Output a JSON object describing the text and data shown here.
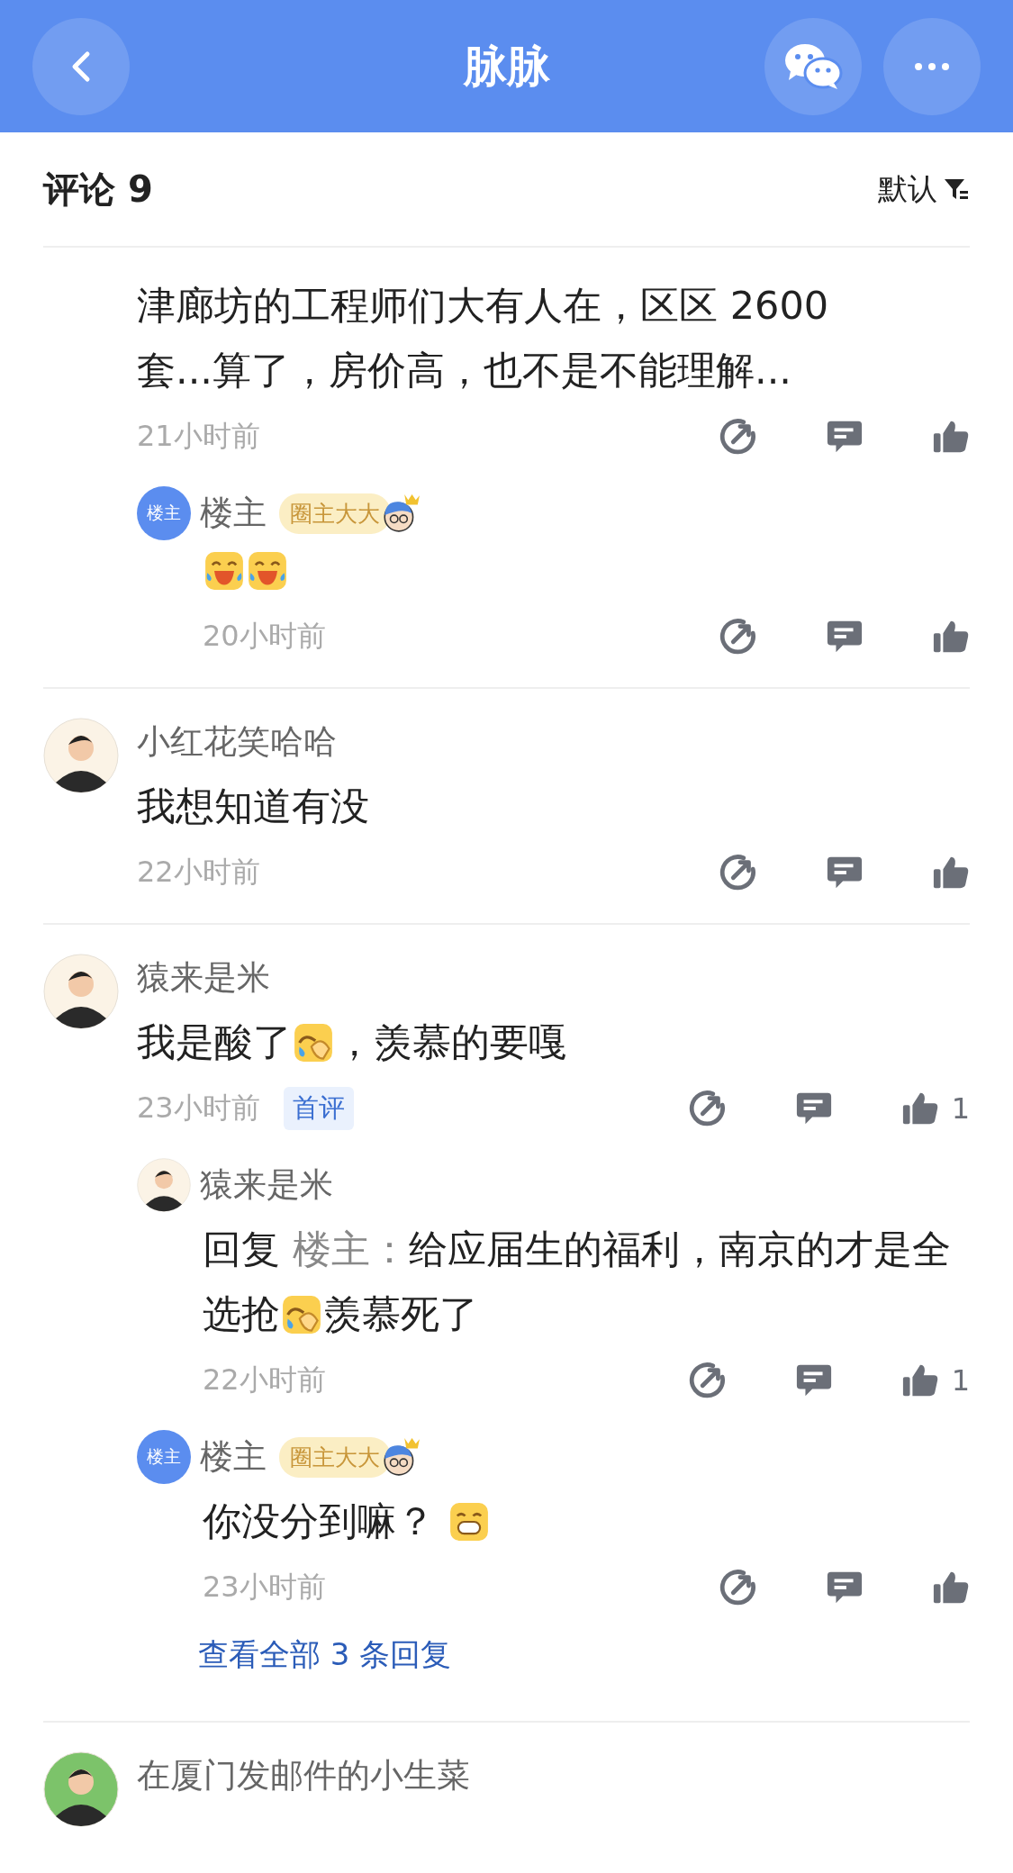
{
  "nav_bar": {
    "title": "脉脉"
  },
  "comments_header": {
    "title": "评论 9",
    "sort": "默认"
  },
  "comments": [
    {
      "text": [
        {
          "kind": "text",
          "text": "津廊坊的工程师们大有人在，区区 2600"
        },
        {
          "kind": "break"
        },
        {
          "kind": "text",
          "text": "套...算了，房价高，也不是不能理解..."
        }
      ],
      "time": "21小时前",
      "replies": [
        {
          "avatar": {
            "kind": "host",
            "label": "楼主"
          },
          "name": "楼主",
          "badge": "圈主大大",
          "text": [
            {
              "kind": "laugh"
            },
            {
              "kind": "laugh"
            }
          ],
          "time": "20小时前"
        }
      ]
    },
    {
      "avatar": {
        "kind": "person",
        "color": "#fbf3e6"
      },
      "name": "小红花笑哈哈",
      "text": [
        {
          "kind": "text",
          "text": "我想知道有没"
        }
      ],
      "time": "22小时前"
    },
    {
      "avatar": {
        "kind": "person",
        "color": "#fbf3e6"
      },
      "name": "猿来是米",
      "text": [
        {
          "kind": "text",
          "text": "我是酸了"
        },
        {
          "kind": "cover"
        },
        {
          "kind": "text",
          "text": "，羡慕的要嘎"
        }
      ],
      "time": "23小时前",
      "tag": "首评",
      "like_count": "1",
      "replies": [
        {
          "avatar": {
            "kind": "person",
            "color": "#fbf3e6"
          },
          "name": "猿来是米",
          "text": [
            {
              "kind": "text",
              "text": "回复 "
            },
            {
              "kind": "mention",
              "text": "楼主："
            },
            {
              "kind": "text",
              "text": "给应届生的福利，南京的才是全选抢"
            },
            {
              "kind": "cover"
            },
            {
              "kind": "text",
              "text": "羡慕死了"
            }
          ],
          "time": "22小时前",
          "like_count": "1"
        },
        {
          "avatar": {
            "kind": "host",
            "label": "楼主"
          },
          "name": "楼主",
          "badge": "圈主大大",
          "text": [
            {
              "kind": "text",
              "text": "你没分到嘛？ "
            },
            {
              "kind": "grin"
            }
          ],
          "time": "23小时前"
        }
      ],
      "more_link": "查看全部 3 条回复"
    },
    {
      "avatar": {
        "kind": "person",
        "color": "#7cc36a"
      },
      "name": "在厦门发邮件的小生菜"
    }
  ]
}
